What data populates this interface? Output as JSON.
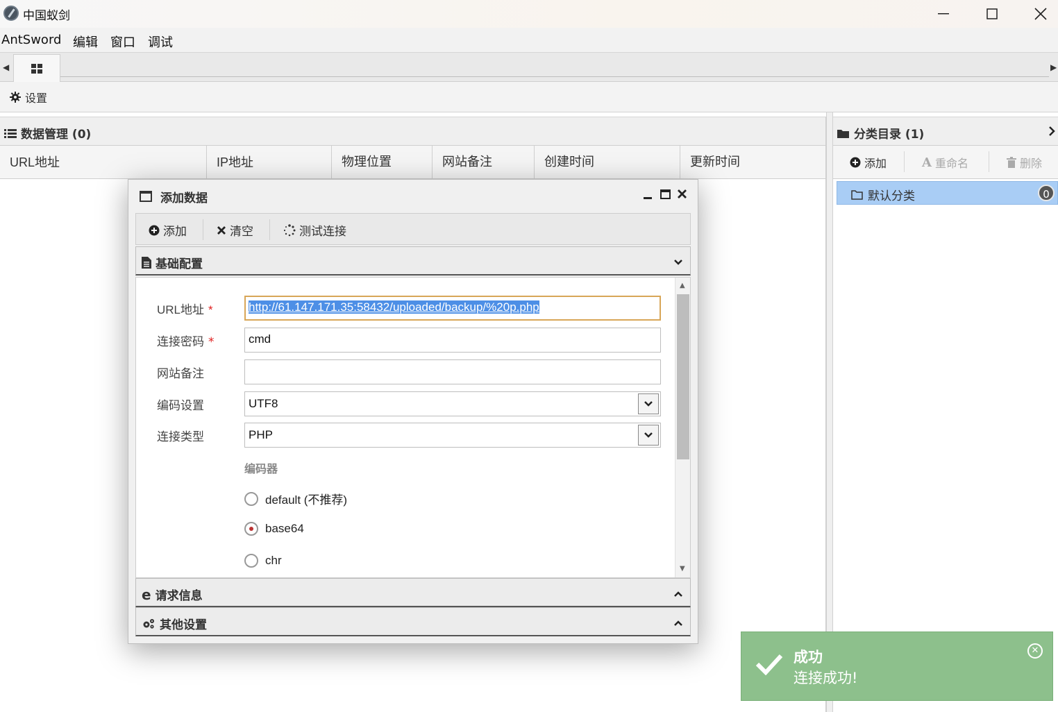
{
  "window": {
    "title": "中国蚁剑",
    "minimize": "─",
    "maximize": "☐",
    "close": "✕"
  },
  "menu": {
    "items": [
      "AntSword",
      "编辑",
      "窗口",
      "调试"
    ]
  },
  "settings": {
    "label": "设置"
  },
  "data_panel": {
    "title": "数据管理 (0)",
    "columns": [
      "URL地址",
      "IP地址",
      "物理位置",
      "网站备注",
      "创建时间",
      "更新时间"
    ]
  },
  "category_panel": {
    "title": "分类目录 (1)",
    "add": "添加",
    "rename": "重命名",
    "delete": "删除",
    "items": [
      {
        "label": "默认分类",
        "count": "0"
      }
    ]
  },
  "dialog": {
    "title": "添加数据",
    "toolbar": {
      "add": "添加",
      "clear": "清空",
      "test": "测试连接"
    },
    "sections": {
      "basic": "基础配置",
      "request": "请求信息",
      "other": "其他设置"
    },
    "fields": {
      "url_label": "URL地址",
      "url_value": "http://61.147.171.35:58432/uploaded/backup/%20p.php",
      "password_label": "连接密码",
      "password_value": "cmd",
      "note_label": "网站备注",
      "note_value": "",
      "encoding_label": "编码设置",
      "encoding_value": "UTF8",
      "type_label": "连接类型",
      "type_value": "PHP",
      "required_mark": "*"
    },
    "encoder": {
      "label": "编码器",
      "options": [
        "default (不推荐)",
        "base64",
        "chr"
      ],
      "selected": "base64"
    }
  },
  "toast": {
    "title": "成功",
    "message": "连接成功!",
    "color": "#8dc08c"
  },
  "colors": {
    "selection": "#a9cdf5",
    "focus_border": "#d8a657"
  }
}
